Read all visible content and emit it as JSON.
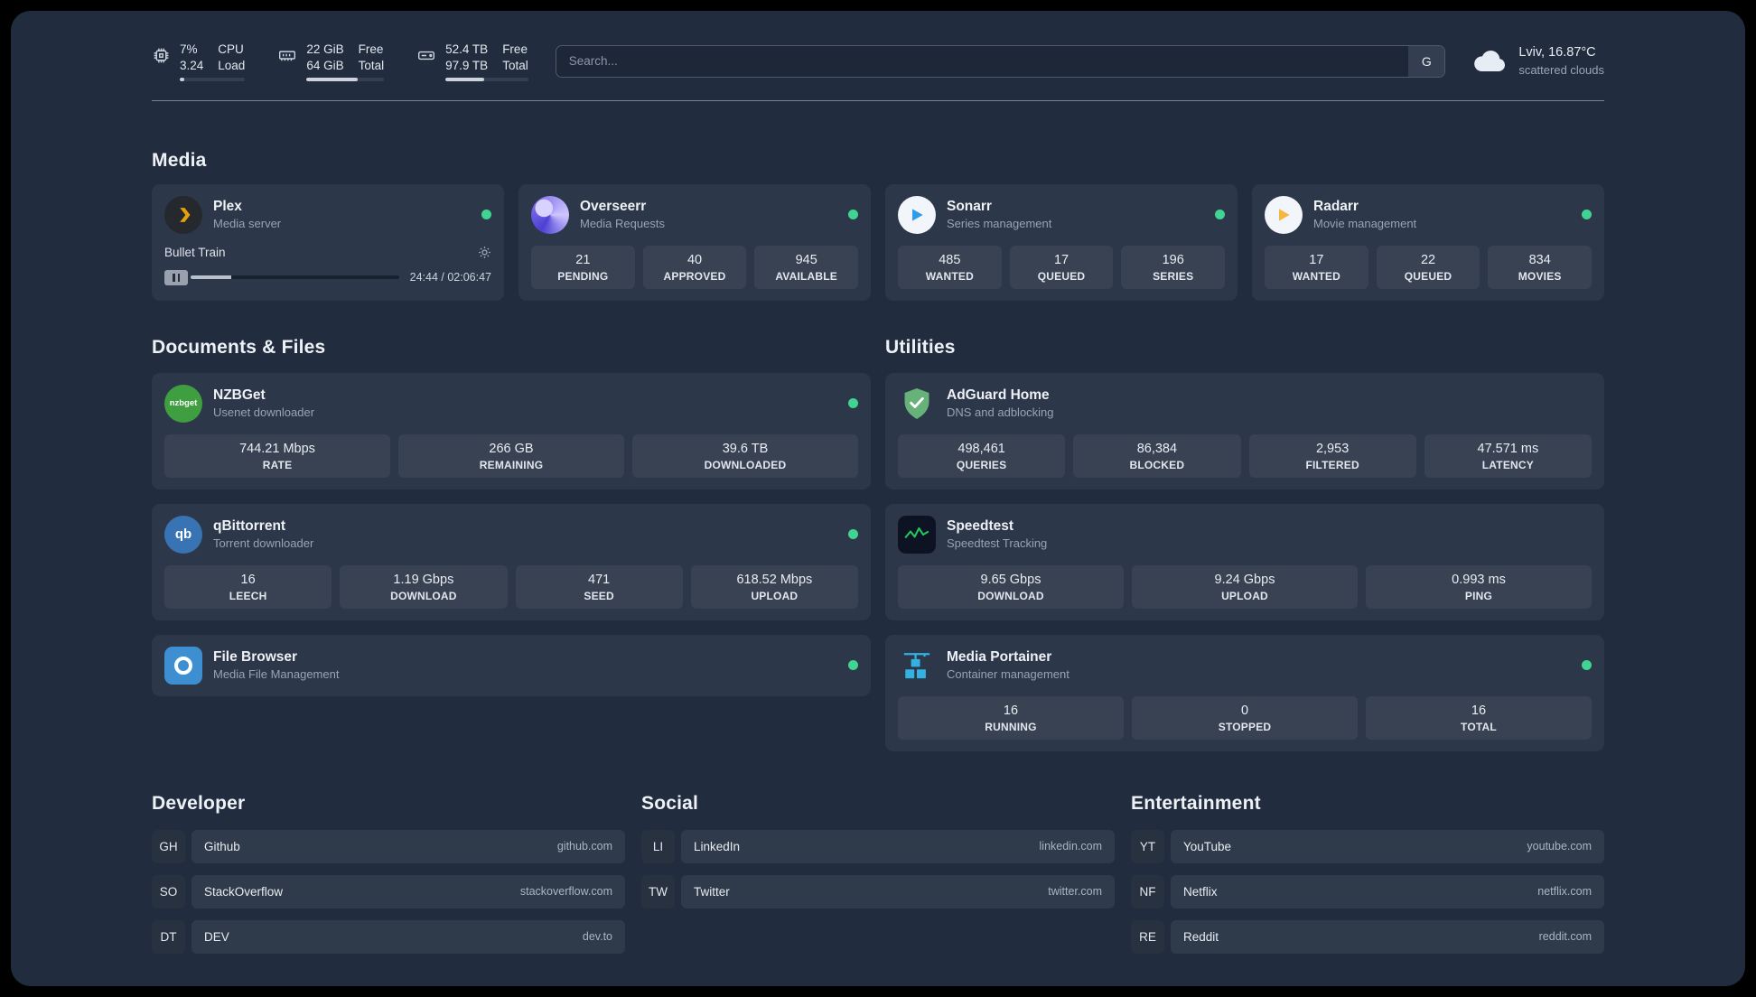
{
  "colors": {
    "background": "#212c3e",
    "card": "#2c3749",
    "status_online": "#41d392",
    "plex_accent": "#e5a00d",
    "sonarr_accent": "#2f9ceb",
    "radarr_accent": "#f5b73d",
    "adguard_green": "#67b279",
    "speedtest_green": "#22c55e",
    "portainer_blue": "#33b1e0"
  },
  "header": {
    "cpu": {
      "icon": "cpu-chip-icon",
      "value_top": "7%",
      "value_bottom": "3.24",
      "label_top": "CPU",
      "label_bottom": "Load",
      "progress_pct": 7
    },
    "memory": {
      "icon": "memory-stick-icon",
      "value_top": "22 GiB",
      "value_bottom": "64 GiB",
      "label_top": "Free",
      "label_bottom": "Total",
      "progress_pct": 66
    },
    "disk": {
      "icon": "hard-drive-icon",
      "value_top": "52.4 TB",
      "value_bottom": "97.9 TB",
      "label_top": "Free",
      "label_bottom": "Total",
      "progress_pct": 47
    },
    "search": {
      "placeholder": "Search...",
      "button_label": "G"
    },
    "weather": {
      "icon": "cloud-icon",
      "location": "Lviv, 16.87°C",
      "condition": "scattered clouds"
    }
  },
  "media": {
    "title": "Media",
    "plex": {
      "name": "Plex",
      "subtitle": "Media server",
      "status": "online",
      "now_playing": "Bullet Train",
      "time": "24:44 / 02:06:47",
      "progress_pct": 19.5
    },
    "overseerr": {
      "name": "Overseerr",
      "subtitle": "Media Requests",
      "status": "online",
      "stats": [
        {
          "value": "21",
          "label": "PENDING"
        },
        {
          "value": "40",
          "label": "APPROVED"
        },
        {
          "value": "945",
          "label": "AVAILABLE"
        }
      ]
    },
    "sonarr": {
      "name": "Sonarr",
      "subtitle": "Series management",
      "status": "online",
      "stats": [
        {
          "value": "485",
          "label": "WANTED"
        },
        {
          "value": "17",
          "label": "QUEUED"
        },
        {
          "value": "196",
          "label": "SERIES"
        }
      ]
    },
    "radarr": {
      "name": "Radarr",
      "subtitle": "Movie management",
      "status": "online",
      "stats": [
        {
          "value": "17",
          "label": "WANTED"
        },
        {
          "value": "22",
          "label": "QUEUED"
        },
        {
          "value": "834",
          "label": "MOVIES"
        }
      ]
    }
  },
  "documents": {
    "title": "Documents & Files",
    "nzbget": {
      "name": "NZBGet",
      "subtitle": "Usenet downloader",
      "status": "online",
      "icon_text": "nzbget",
      "stats": [
        {
          "value": "744.21 Mbps",
          "label": "RATE"
        },
        {
          "value": "266 GB",
          "label": "REMAINING"
        },
        {
          "value": "39.6 TB",
          "label": "DOWNLOADED"
        }
      ]
    },
    "qbittorrent": {
      "name": "qBittorrent",
      "subtitle": "Torrent downloader",
      "status": "online",
      "icon_text": "qb",
      "stats": [
        {
          "value": "16",
          "label": "LEECH"
        },
        {
          "value": "1.19 Gbps",
          "label": "DOWNLOAD"
        },
        {
          "value": "471",
          "label": "SEED"
        },
        {
          "value": "618.52 Mbps",
          "label": "UPLOAD"
        }
      ]
    },
    "filebrowser": {
      "name": "File Browser",
      "subtitle": "Media File Management",
      "status": "online"
    }
  },
  "utilities": {
    "title": "Utilities",
    "adguard": {
      "name": "AdGuard Home",
      "subtitle": "DNS and adblocking",
      "stats": [
        {
          "value": "498,461",
          "label": "QUERIES"
        },
        {
          "value": "86,384",
          "label": "BLOCKED"
        },
        {
          "value": "2,953",
          "label": "FILTERED"
        },
        {
          "value": "47.571 ms",
          "label": "LATENCY"
        }
      ]
    },
    "speedtest": {
      "name": "Speedtest",
      "subtitle": "Speedtest Tracking",
      "stats": [
        {
          "value": "9.65 Gbps",
          "label": "DOWNLOAD"
        },
        {
          "value": "9.24 Gbps",
          "label": "UPLOAD"
        },
        {
          "value": "0.993 ms",
          "label": "PING"
        }
      ]
    },
    "portainer": {
      "name": "Media Portainer",
      "subtitle": "Container management",
      "status": "online",
      "stats": [
        {
          "value": "16",
          "label": "RUNNING"
        },
        {
          "value": "0",
          "label": "STOPPED"
        },
        {
          "value": "16",
          "label": "TOTAL"
        }
      ]
    }
  },
  "bookmarks": {
    "developer": {
      "title": "Developer",
      "items": [
        {
          "abbr": "GH",
          "name": "Github",
          "url": "github.com"
        },
        {
          "abbr": "SO",
          "name": "StackOverflow",
          "url": "stackoverflow.com"
        },
        {
          "abbr": "DT",
          "name": "DEV",
          "url": "dev.to"
        }
      ]
    },
    "social": {
      "title": "Social",
      "items": [
        {
          "abbr": "LI",
          "name": "LinkedIn",
          "url": "linkedin.com"
        },
        {
          "abbr": "TW",
          "name": "Twitter",
          "url": "twitter.com"
        }
      ]
    },
    "entertainment": {
      "title": "Entertainment",
      "items": [
        {
          "abbr": "YT",
          "name": "YouTube",
          "url": "youtube.com"
        },
        {
          "abbr": "NF",
          "name": "Netflix",
          "url": "netflix.com"
        },
        {
          "abbr": "RE",
          "name": "Reddit",
          "url": "reddit.com"
        }
      ]
    }
  }
}
